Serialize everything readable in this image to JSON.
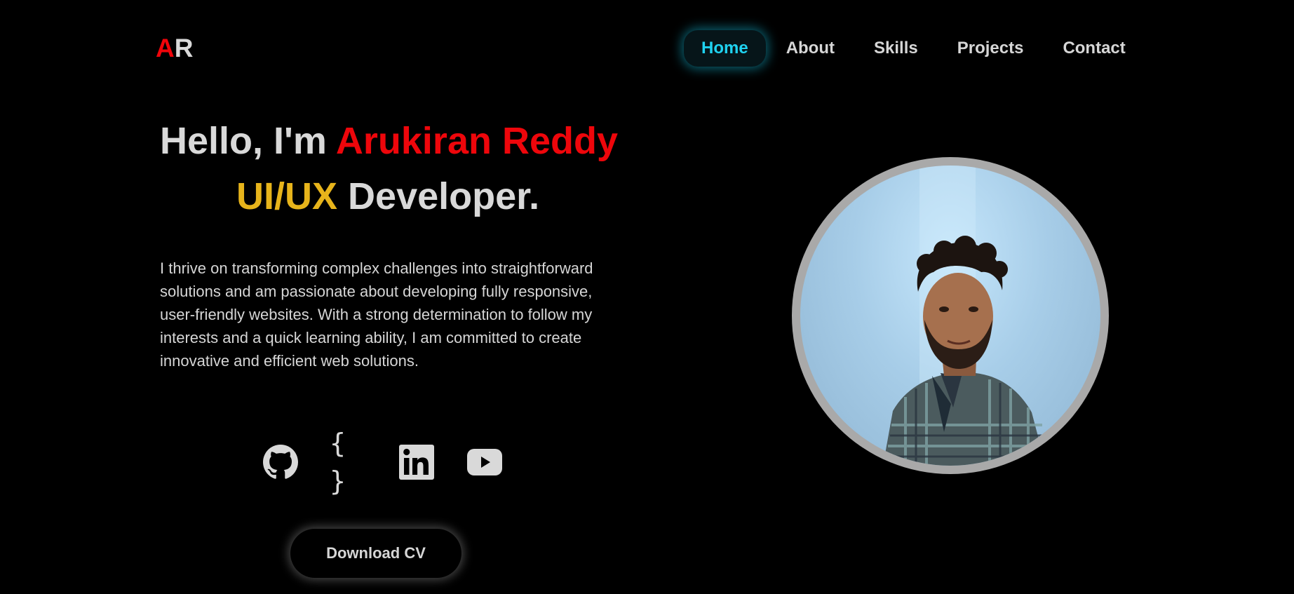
{
  "logo": {
    "first": "A",
    "second": "R"
  },
  "nav": {
    "items": [
      {
        "label": "Home",
        "active": true
      },
      {
        "label": "About",
        "active": false
      },
      {
        "label": "Skills",
        "active": false
      },
      {
        "label": "Projects",
        "active": false
      },
      {
        "label": "Contact",
        "active": false
      }
    ]
  },
  "hero": {
    "greeting": "Hello, I'm",
    "name": "Arukiran Reddy",
    "role_highlight": "UI/UX",
    "role_rest": "Developer.",
    "intro": "I thrive on transforming complex challenges into straightforward solutions and am passionate about developing fully responsive, user-friendly websites. With a strong determination to follow my interests and a quick learning ability, I am committed to create innovative and efficient web solutions."
  },
  "social": [
    {
      "icon": "github-icon"
    },
    {
      "icon": "code-braces-icon",
      "glyph": "{ }"
    },
    {
      "icon": "linkedin-icon"
    },
    {
      "icon": "youtube-icon"
    }
  ],
  "cta": {
    "download_label": "Download CV"
  },
  "colors": {
    "background": "#000000",
    "accent_red": "#ee060b",
    "accent_yellow": "#e7b41b",
    "accent_cyan": "#1fd2f0",
    "text": "#d9d9d9"
  }
}
